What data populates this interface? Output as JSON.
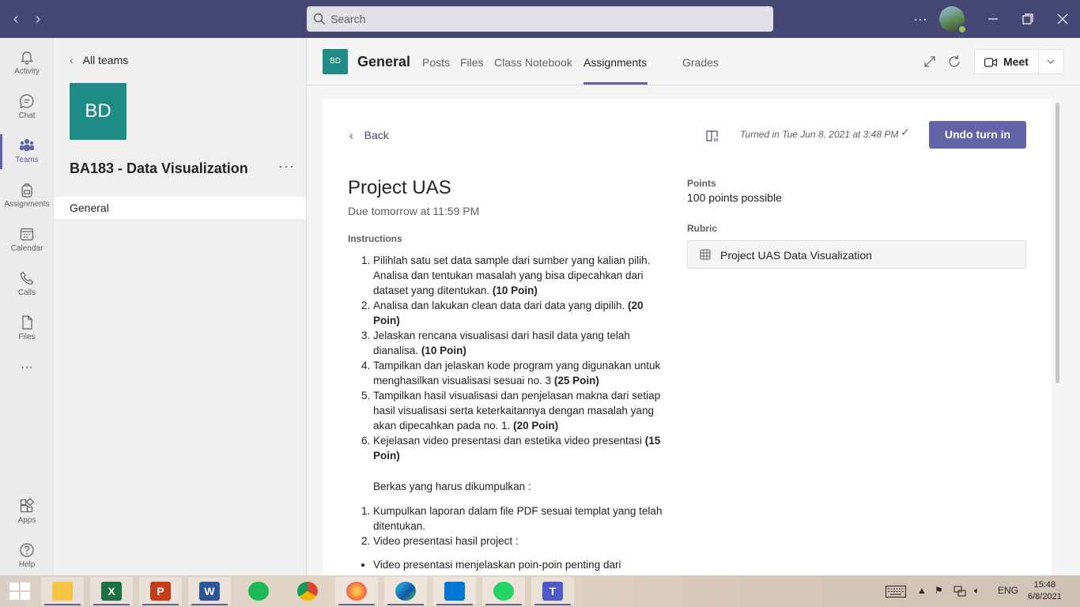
{
  "titlebar": {
    "search_placeholder": "Search",
    "more": "···"
  },
  "rail": [
    {
      "label": "Activity"
    },
    {
      "label": "Chat"
    },
    {
      "label": "Teams"
    },
    {
      "label": "Assignments"
    },
    {
      "label": "Calendar"
    },
    {
      "label": "Calls"
    },
    {
      "label": "Files"
    },
    {
      "label": "Apps"
    },
    {
      "label": "Help"
    }
  ],
  "rail_more": "···",
  "team": {
    "all_teams": "All teams",
    "avatar_initials": "BD",
    "name": "BA183 - Data Visualization",
    "more": "···",
    "channel": "General"
  },
  "header": {
    "avatar_initials": "BD",
    "channel": "General",
    "tabs": [
      "Posts",
      "Files",
      "Class Notebook",
      "Assignments",
      "Grades"
    ],
    "active_tab": "Assignments",
    "meet_label": "Meet"
  },
  "assignment": {
    "back": "Back",
    "turned_in": "Turned in Tue Jun 8, 2021 at 3:48 PM",
    "undo_button": "Undo turn in",
    "title": "Project UAS",
    "due": "Due tomorrow at 11:59 PM",
    "instructions_heading": "Instructions",
    "instructions": [
      {
        "text": "Pilihlah satu set data sample dari sumber yang kalian pilih. Analisa dan tentukan masalah yang bisa dipecahkan dari dataset yang ditentukan.",
        "points": "(10 Poin)"
      },
      {
        "text": "Analisa dan lakukan clean data dari data yang dipilih.",
        "points": "(20 Poin)"
      },
      {
        "text": "Jelaskan rencana visualisasi dari hasil data yang telah dianalisa.",
        "points": "(10 Poin)"
      },
      {
        "text": "Tampilkan dan jelaskan kode program yang digunakan untuk menghasilkan visualisasi sesuai no. 3",
        "points": "(25 Poin)"
      },
      {
        "text": "Tampilkan hasil visualisasi dan penjelasan makna dari setiap hasil visualisasi serta keterkaitannya dengan masalah yang akan dipecahkan pada no. 1.",
        "points": "(20 Poin)"
      },
      {
        "text": "Kejelasan video presentasi dan estetika video presentasi",
        "points": "(15 Poin)"
      }
    ],
    "files_heading": "Berkas yang harus dikumpulkan :",
    "files": [
      "Kumpulkan laporan dalam file PDF sesuai templat yang telah ditentukan.",
      "Video presentasi hasil project :"
    ],
    "video_bullets": [
      "Video presentasi menjelaskan poin-poin penting dari"
    ],
    "points_label": "Points",
    "points_value": "100 points possible",
    "rubric_label": "Rubric",
    "rubric_name": "Project UAS Data Visualization"
  },
  "taskbar": {
    "apps": [
      "file-explorer",
      "excel",
      "powerpoint",
      "word",
      "spotify",
      "chrome",
      "firefox",
      "edge",
      "vscode",
      "whatsapp",
      "teams"
    ],
    "lang": "ENG",
    "time": "15:48",
    "date": "6/8/2021"
  },
  "colors": {
    "titlebar": "#464775",
    "accent": "#6264a7",
    "team_avatar": "#1f8b87"
  }
}
